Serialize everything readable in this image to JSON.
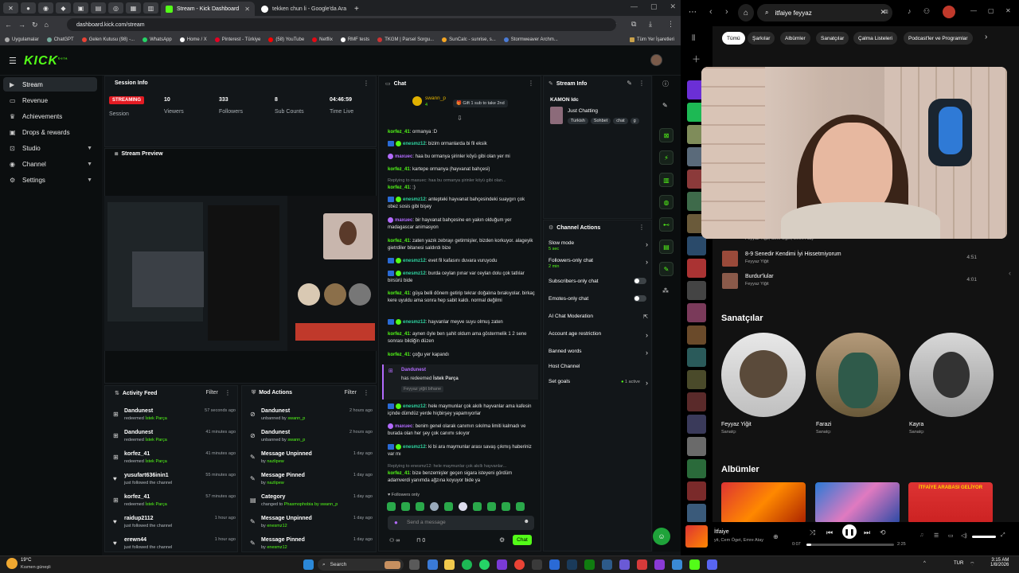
{
  "browser": {
    "tabs": [
      {
        "label": "Stream - Kick Dashboard",
        "active": true
      },
      {
        "label": "tekken chun li - Google'da Ara",
        "active": false
      }
    ],
    "url": "dashboard.kick.com/stream",
    "bookmarks": [
      "Uygulamalar",
      "ChatGPT",
      "Gelen Kutusu (98) -...",
      "WhatsApp",
      "Home / X",
      "Pinterest - Türkiye",
      "(58) YouTube",
      "Netflix",
      "RMF tests",
      "TKGM | Parsel Sorgu...",
      "SunCalc - sunrise, s...",
      "Stormweaver Archm..."
    ],
    "bookmarks_folder": "Tüm Yer İşaretleri"
  },
  "kick": {
    "logo": "KICK",
    "logo_sup": "beta",
    "sidebar": [
      {
        "label": "Stream",
        "icon": "play-icon",
        "active": true
      },
      {
        "label": "Revenue",
        "icon": "wallet-icon"
      },
      {
        "label": "Achievements",
        "icon": "trophy-icon"
      },
      {
        "label": "Drops & rewards",
        "icon": "gift-icon"
      },
      {
        "label": "Studio",
        "icon": "video-icon",
        "chevron": true
      },
      {
        "label": "Channel",
        "icon": "user-icon",
        "chevron": true
      },
      {
        "label": "Settings",
        "icon": "gear-icon",
        "chevron": true
      }
    ],
    "session": {
      "title": "Session Info",
      "status_badge": "STREAMING",
      "status_label": "Session",
      "stats": [
        {
          "value": "10",
          "label": "Viewers"
        },
        {
          "value": "333",
          "label": "Followers"
        },
        {
          "value": "8",
          "label": "Sub Counts"
        },
        {
          "value": "04:46:59",
          "label": "Time Live"
        }
      ]
    },
    "preview": {
      "title": "Stream Preview"
    },
    "activity": {
      "title": "Activity Feed",
      "filter": "Filter",
      "items": [
        {
          "name": "Dandunest",
          "action": "redeemed",
          "detail": "İstek Parça",
          "time": "57 seconds ago"
        },
        {
          "name": "Dandunest",
          "action": "redeemed",
          "detail": "İstek Parça",
          "time": "41 minutes ago"
        },
        {
          "name": "korfez_41",
          "action": "redeemed",
          "detail": "İstek Parça",
          "time": "41 minutes ago"
        },
        {
          "name": "yusufart636inin1",
          "action": "just followed the channel",
          "detail": "",
          "time": "55 minutes ago"
        },
        {
          "name": "korfez_41",
          "action": "redeemed",
          "detail": "İstek Parça",
          "time": "57 minutes ago"
        },
        {
          "name": "raidup2112",
          "action": "just followed the channel",
          "detail": "",
          "time": "1 hour ago"
        },
        {
          "name": "erewn44",
          "action": "just followed the channel",
          "detail": "",
          "time": "1 hour ago"
        }
      ]
    },
    "mod": {
      "title": "Mod Actions",
      "filter": "Filter",
      "items": [
        {
          "name": "Dandunest",
          "action": "unbanned by",
          "by": "swann_p",
          "time": "2 hours ago"
        },
        {
          "name": "Dandunest",
          "action": "unbanned by",
          "by": "swann_p",
          "time": "2 hours ago"
        },
        {
          "name": "Message Unpinned",
          "action": "by",
          "by": "nazlipew",
          "time": "1 day ago"
        },
        {
          "name": "Message Pinned",
          "action": "by",
          "by": "nazlipew",
          "time": "1 day ago"
        },
        {
          "name": "Category",
          "action": "changed to",
          "by": "Phasmophobia by swann_p",
          "time": "1 day ago"
        },
        {
          "name": "Message Unpinned",
          "action": "by",
          "by": "enesmz12",
          "time": "1 day ago"
        },
        {
          "name": "Message Pinned",
          "action": "by",
          "by": "enesmz12",
          "time": "1 day ago"
        }
      ]
    },
    "chat": {
      "title": "Chat",
      "pinned_user": "swann_p",
      "pinned_count": "4",
      "gift_text": "Gift 1 sub to take 2nd",
      "messages": [
        {
          "user": "korfez_41",
          "color": "green",
          "text": "ormanya :D"
        },
        {
          "user": "enesmz12",
          "color": "teal",
          "text": "bizim ormanlarda bi fil eksik"
        },
        {
          "user": "maxuec",
          "color": "purple",
          "text": "haa bu ormanya şirinler köyü gibi olan yer mi"
        },
        {
          "user": "korfez_41",
          "color": "green",
          "text": "kartepe ormanya (hayvanat bahçesi)"
        },
        {
          "user": "korfez_41",
          "color": "green",
          "text": ":)",
          "reply": "Replying to maxuec: haa bu ormanya şirinler köyü gibi olan..."
        },
        {
          "user": "enesmz12",
          "color": "teal",
          "text": "antepteki hayvanat bahçesindeki suaygırı çok obez sosis gibi bişey"
        },
        {
          "user": "maxuec",
          "color": "purple",
          "text": "bir hayvanat bahçesine en yakın olduğum yer madagascar animasyon"
        },
        {
          "user": "korfez_41",
          "color": "green",
          "text": "zaten yazık zebrayı getirmişler, bizden korkuyor. alageyik gietrdiler bitanesi saldırdı bize"
        },
        {
          "user": "enesmz12",
          "color": "teal",
          "text": "evet fil kafasını duvara vuruyodu"
        },
        {
          "user": "enesmz12",
          "color": "teal",
          "text": "burda ceylan pınar var ceylan dolu çok tatlılar birsürü bide"
        },
        {
          "user": "korfez_41",
          "color": "green",
          "text": "güya belli dönem getirip tekrar doğalına bırakıyolar. birkaç kere uyuldu ama sonra hep sabit kaldı. normal değilmi"
        },
        {
          "user": "enesmz12",
          "color": "teal",
          "text": "hayvanlar meyve suyu olmuş zaten"
        },
        {
          "user": "korfez_41",
          "color": "green",
          "text": "aynen öyle ben şahit oldum ama göstermelik 1 2 sene sonrası bildiğin düzen"
        },
        {
          "user": "korfez_41",
          "color": "green",
          "text": "çoğu yer kapandı"
        },
        {
          "user": "enesmz12",
          "color": "teal",
          "text": "hele maymunlar çok akıllı hayvanlar ama kafesin içinde dümdüz yerde hiçbirşey yapamıyorlar"
        },
        {
          "user": "maxuec",
          "color": "purple",
          "text": "benim genel olarak canımın sıkılma limiti kalmadı ve burada olan her şey çok canımı sıkıyor"
        },
        {
          "user": "enesmz12",
          "color": "teal",
          "text": "ki bi ara maymunlar arası savaş çıkmış haberiniz var mı"
        },
        {
          "user": "korfez_41",
          "color": "green",
          "text": "bize benzemişler geçen sigara isteyeni gördüm adamverdi yanımda ağzına koyuyor bide ya",
          "reply": "Replying to enesmz12: hele maymunlar çok akıllı hayvanlar..."
        }
      ],
      "redeem": {
        "user": "Dandunest",
        "text": "has redeemed",
        "reward": "İstek Parça",
        "note": "Feyyaz yiğit bihane"
      },
      "followers_only": "Followers only",
      "input_placeholder": "Send a message",
      "count": "0",
      "send_label": "Chat"
    },
    "stream_info": {
      "title": "Stream Info",
      "stream_title": "KAMON Idc",
      "category": "Just Chatting",
      "tags": [
        "Turkish",
        "Sohbet",
        "chat",
        "g"
      ]
    },
    "channel_actions": {
      "title": "Channel Actions",
      "items": [
        {
          "label": "Slow mode",
          "sub": "5 sec",
          "control": "arrow"
        },
        {
          "label": "Followers-only chat",
          "sub": "2 min",
          "control": "arrow"
        },
        {
          "label": "Subscribers-only chat",
          "sub": "",
          "control": "toggle"
        },
        {
          "label": "Emotes-only chat",
          "sub": "",
          "control": "toggle"
        },
        {
          "label": "AI Chat Moderation",
          "sub": "",
          "control": "external"
        },
        {
          "label": "Account age restriction",
          "sub": "",
          "control": "arrow"
        },
        {
          "label": "Banned words",
          "sub": "",
          "control": "arrow"
        },
        {
          "label": "Host Channel",
          "sub": "",
          "control": "none"
        },
        {
          "label": "Set goals",
          "sub": "",
          "control": "arrow",
          "badge": "1 active"
        }
      ]
    }
  },
  "spotify": {
    "search_value": "itfaiye feyyaz",
    "chips": [
      "Tümü",
      "Şarkılar",
      "Albümler",
      "Sanatçılar",
      "Çalma Listeleri",
      "Podcast'ler ve Programlar"
    ],
    "tracks": [
      {
        "title": "8-9 Senedir Kendimi İyi Hissetmiyorum",
        "artist": "Feyyaz Yiğit",
        "duration": "4:51"
      },
      {
        "title": "Burdur'lular",
        "artist": "Feyyaz Yiğit",
        "duration": "4:01"
      }
    ],
    "partial_track_artist": "Feyyaz Yiğit, Cem Öget, Emre Atay",
    "artists_heading": "Sanatçılar",
    "artists": [
      {
        "name": "Feyyaz Yiğit",
        "kind": "Sanatçı"
      },
      {
        "name": "Farazi",
        "kind": "Sanatçı"
      },
      {
        "name": "Kayra",
        "kind": "Sanatçı"
      }
    ],
    "albums_heading": "Albümler",
    "album_overlay_text": "İTFAİYE ARABASI GELİYOR",
    "now_playing": {
      "title": "İtfaiye",
      "artist": "yit, Cem Öget, Emre Atay",
      "elapsed": "0:07",
      "total": "2:25",
      "progress": 0.05
    }
  },
  "taskbar": {
    "weather_temp": "19°C",
    "weather_text": "Kısmen güneşli",
    "search_label": "Search",
    "lang": "TUR",
    "time": "3:15 AM",
    "date": "1/8/2026"
  }
}
